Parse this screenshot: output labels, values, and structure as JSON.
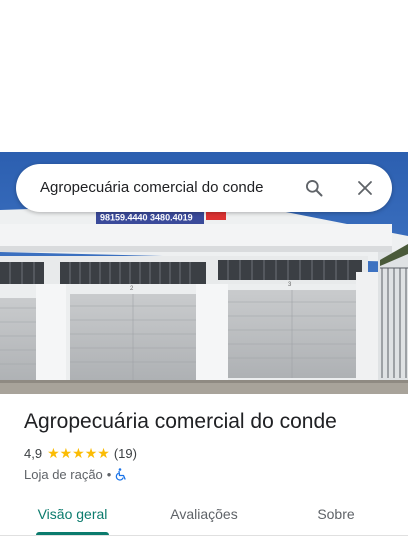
{
  "search": {
    "query": "Agropecuária comercial do conde"
  },
  "photo": {
    "sign_text": "98159.4440 3480.4019",
    "door_numbers": [
      "2",
      "3"
    ]
  },
  "place": {
    "name": "Agropecuária comercial do conde",
    "rating": "4,9",
    "stars": "★★★★★",
    "review_count": "(19)",
    "category": "Loja de ração",
    "separator": "•"
  },
  "tabs": [
    {
      "label": "Visão geral",
      "active": true
    },
    {
      "label": "Avaliações",
      "active": false
    },
    {
      "label": "Sobre",
      "active": false
    }
  ],
  "colors": {
    "accent": "#0b7b6d",
    "star": "#fbbc04",
    "accessibility": "#1a73e8"
  },
  "icons": {
    "search": "search-icon",
    "close": "close-icon",
    "accessibility": "wheelchair-icon"
  }
}
